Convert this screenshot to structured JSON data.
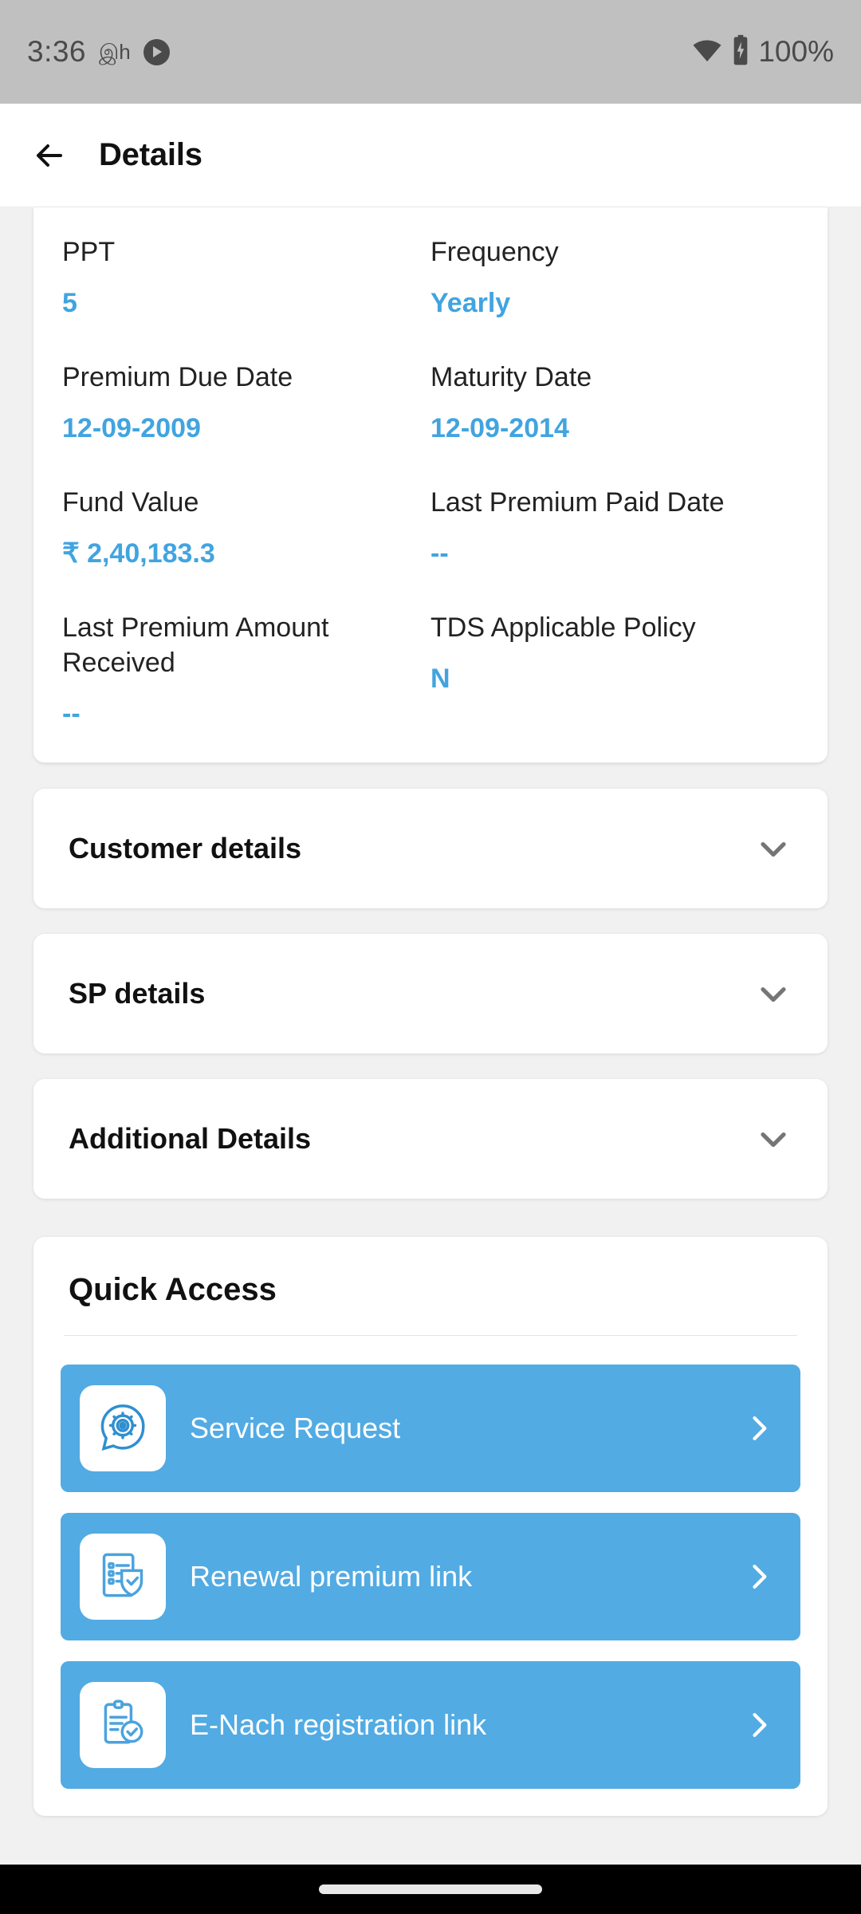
{
  "status_bar": {
    "time": "3:36",
    "small_glyph": "இh",
    "play_icon": "play-circle-icon",
    "wifi_icon": "wifi-icon",
    "battery_icon": "battery-charging-icon",
    "battery_percent": "100%"
  },
  "app_bar": {
    "back_icon": "arrow-left-icon",
    "title": "Details"
  },
  "colors": {
    "accent_blue": "#41a4e0",
    "button_blue": "#52ABE3",
    "label_dark": "#222222",
    "chevron_gray": "#757575",
    "status_bar_gray": "#c0c0c0",
    "page_bg": "#f1f1f1"
  },
  "policy_details": {
    "rows": [
      [
        {
          "label": "PPT",
          "value": "5"
        },
        {
          "label": "Frequency",
          "value": "Yearly"
        }
      ],
      [
        {
          "label": "Premium Due Date",
          "value": "12-09-2009"
        },
        {
          "label": "Maturity Date",
          "value": "12-09-2014"
        }
      ],
      [
        {
          "label": "Fund Value",
          "value": "₹ 2,40,183.3"
        },
        {
          "label": "Last Premium Paid Date",
          "value": "--"
        }
      ],
      [
        {
          "label": "Last Premium Amount Received",
          "value": "--"
        },
        {
          "label": "TDS Applicable Policy",
          "value": "N"
        }
      ]
    ]
  },
  "accordions": [
    {
      "title": "Customer details",
      "chevron": "chevron-down-icon"
    },
    {
      "title": "SP details",
      "chevron": "chevron-down-icon"
    },
    {
      "title": "Additional Details",
      "chevron": "chevron-down-icon"
    }
  ],
  "quick_access": {
    "title": "Quick Access",
    "items": [
      {
        "label": "Service Request",
        "icon": "service-request-gear-chat-icon",
        "arrow": "chevron-right-icon"
      },
      {
        "label": "Renewal premium link",
        "icon": "document-shield-check-icon",
        "arrow": "chevron-right-icon"
      },
      {
        "label": "E-Nach registration link",
        "icon": "clipboard-check-icon",
        "arrow": "chevron-right-icon"
      }
    ]
  },
  "nav_bar": {
    "home_indicator": "home-pill-indicator"
  }
}
